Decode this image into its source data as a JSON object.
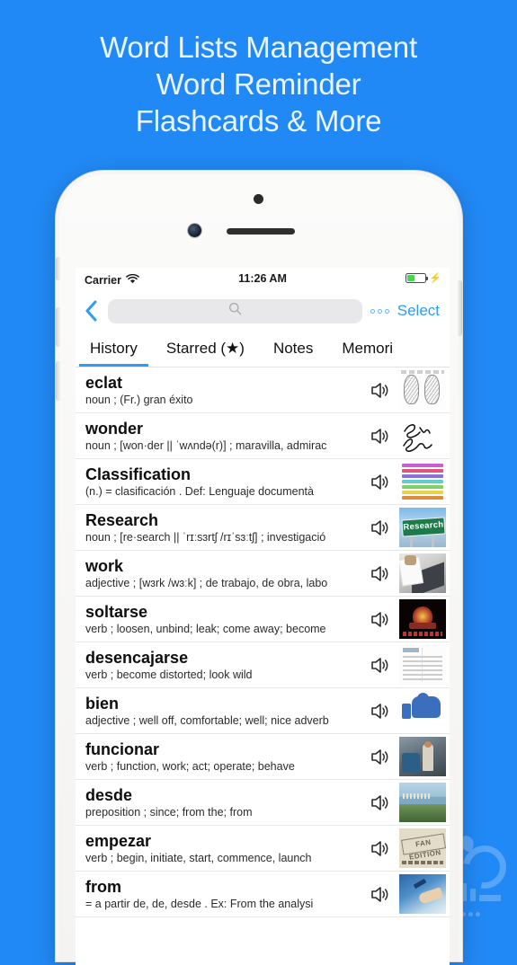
{
  "headline": {
    "line1": "Word Lists Management",
    "line2": "Word Reminder",
    "line3": "Flashcards & More"
  },
  "colors": {
    "background": "#2189f5",
    "accent": "#2d9cf5",
    "battery_green": "#4cd451"
  },
  "statusbar": {
    "carrier": "Carrier",
    "wifi_icon": "wifi-icon",
    "time": "11:26 AM",
    "battery_icon": "battery-icon",
    "charging_icon": "lightning-bolt-icon"
  },
  "navbar": {
    "back_icon": "chevron-left-icon",
    "search_placeholder": "",
    "search_value": "",
    "search_icon": "search-icon",
    "more_icon": "more-options-icon",
    "select_label": "Select"
  },
  "tabs": [
    {
      "label": "History",
      "active": true
    },
    {
      "label": "Starred (★)",
      "active": false
    },
    {
      "label": "Notes",
      "active": false
    },
    {
      "label": "Memori",
      "active": false
    }
  ],
  "list": [
    {
      "word": "eclat",
      "definition": "noun ; (Fr.) gran éxito",
      "speaker_icon": "speaker-icon",
      "thumb": "anatomy-diagram-thumbnail"
    },
    {
      "word": "wonder",
      "definition": "noun ; [won·der || ˈwʌndə(r)] ; maravilla, admirac",
      "speaker_icon": "speaker-icon",
      "thumb": "signature-thumbnail"
    },
    {
      "word": "Classification",
      "definition": "(n.)  =  clasificación .   Def:  Lenguaje documentà",
      "speaker_icon": "speaker-icon",
      "thumb": "color-bars-thumbnail"
    },
    {
      "word": "Research",
      "definition": "noun ; [re·search || ˈrɪːsɜrtʃ /rɪˈsɜːtʃ] ; investigació",
      "speaker_icon": "speaker-icon",
      "thumb": "research-sign-thumbnail"
    },
    {
      "word": "work",
      "definition": "adjective ; [wɜrk /wɜːk] ; de trabajo, de obra, labo",
      "speaker_icon": "speaker-icon",
      "thumb": "desk-keyboard-thumbnail"
    },
    {
      "word": "soltarse",
      "definition": "verb ; loosen, unbind; leak; come away; become",
      "speaker_icon": "speaker-icon",
      "thumb": "dark-logo-thumbnail"
    },
    {
      "word": "desencajarse",
      "definition": "verb ; become distorted; look wild",
      "speaker_icon": "speaker-icon",
      "thumb": "document-scan-thumbnail"
    },
    {
      "word": "bien",
      "definition": "adjective ; well off, comfortable; well; nice adverb",
      "speaker_icon": "speaker-icon",
      "thumb": "thumbs-up-thumbnail"
    },
    {
      "word": "funcionar",
      "definition": "verb ; function, work; act; operate; behave",
      "speaker_icon": "speaker-icon",
      "thumb": "worker-photo-thumbnail"
    },
    {
      "word": "desde",
      "definition": "preposition ; since; from the; from",
      "speaker_icon": "speaker-icon",
      "thumb": "landscape-thumbnail"
    },
    {
      "word": "empezar",
      "definition": "verb ; begin, initiate, start, commence, launch",
      "speaker_icon": "speaker-icon",
      "thumb": "fan-edition-thumbnail"
    },
    {
      "word": "from",
      "definition": "=  a partir de, de, desde .   Ex: From  the  analysi",
      "speaker_icon": "speaker-icon",
      "thumb": "sea-hand-thumbnail"
    }
  ],
  "thumb_bar_colors": [
    "#c85fd0",
    "#e0567a",
    "#8f6fd8",
    "#5fd0c8",
    "#7ed06a",
    "#e8d24a",
    "#e08a3c",
    "#c86a2a"
  ],
  "research_sign_text": "Research",
  "fan_edition_text": "FAN EDITION"
}
